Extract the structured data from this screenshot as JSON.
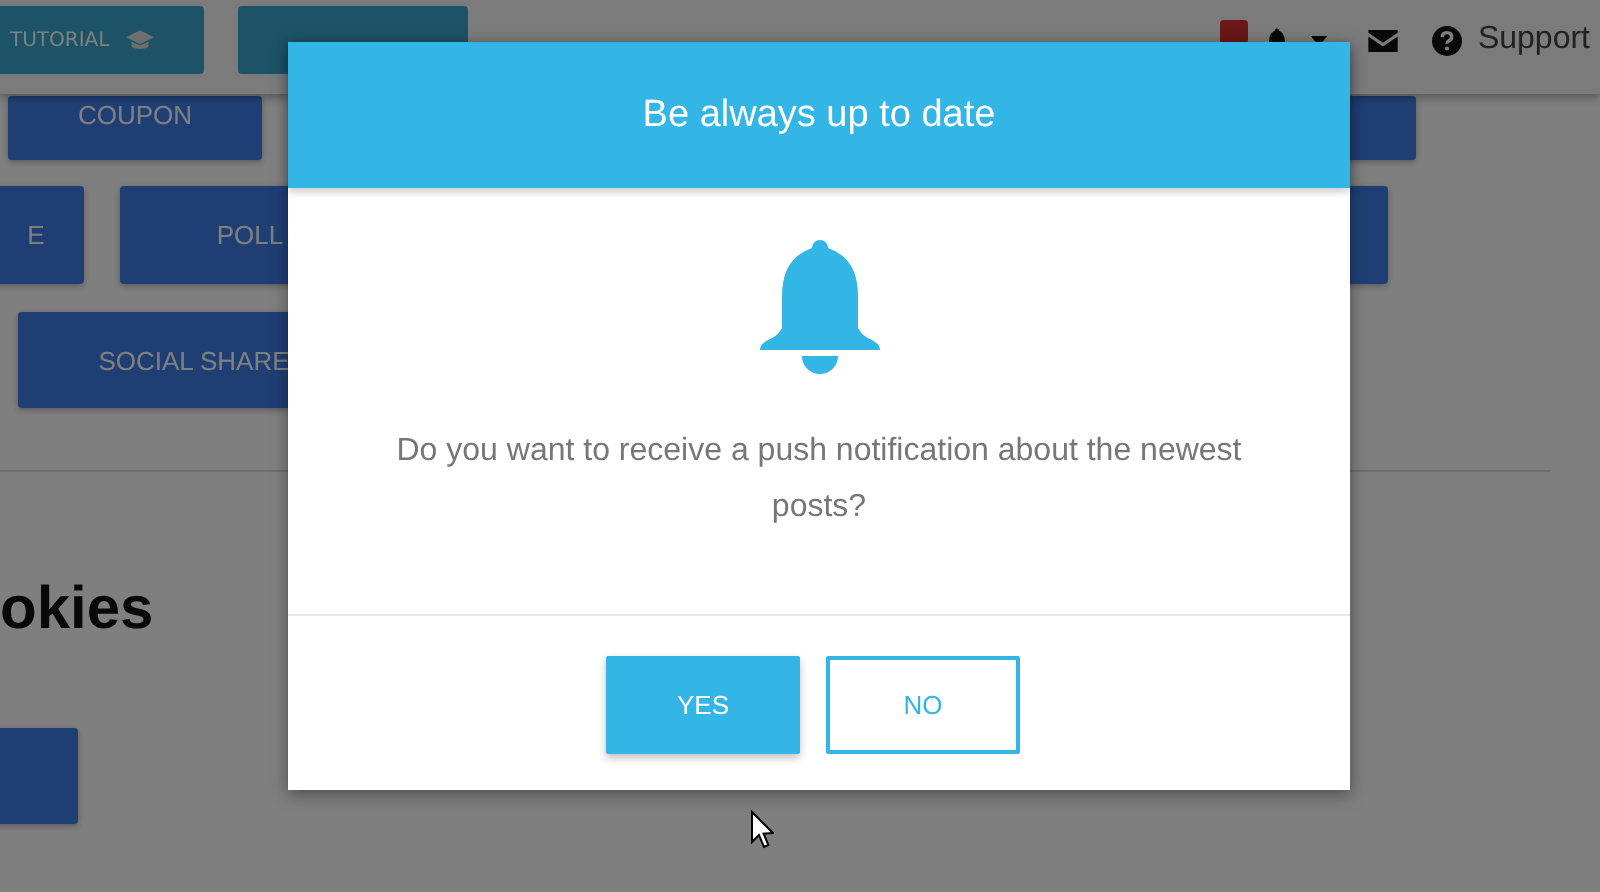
{
  "top_bar": {
    "nav_buttons": [
      {
        "label": "TUTORIAL",
        "kind": "tutorial"
      },
      {
        "kind": "pricing"
      }
    ],
    "support_link": "Support"
  },
  "page_buttons": [
    "COUPON",
    "E",
    "POLL",
    "SOCIAL SHARE"
  ],
  "heading": "okies",
  "dialog": {
    "title": "Be always up to date",
    "message": "Do you want to receive a push notification about the newest posts?",
    "buttons": [
      {
        "label": "YES",
        "kind": "primary"
      },
      {
        "label": "NO",
        "kind": "outline"
      }
    ]
  }
}
